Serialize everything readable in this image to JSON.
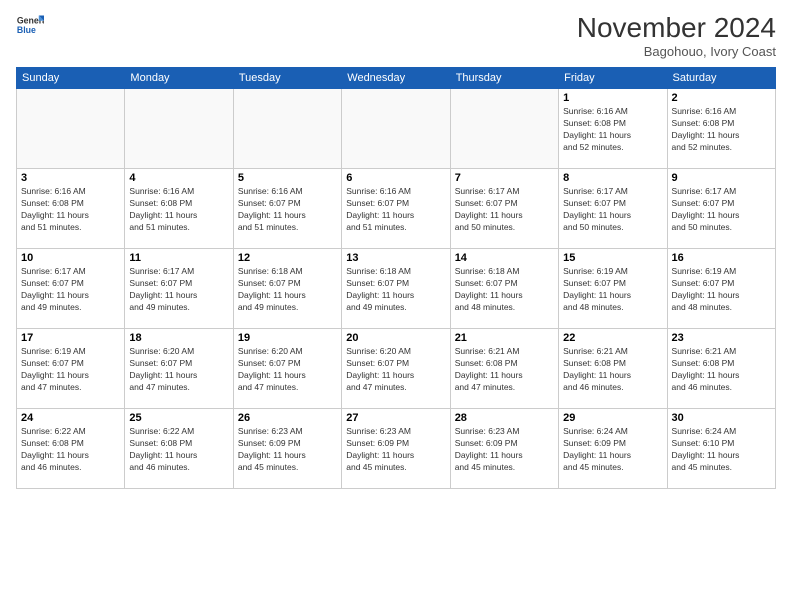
{
  "header": {
    "logo": {
      "line1": "General",
      "line2": "Blue"
    },
    "title": "November 2024",
    "subtitle": "Bagohouo, Ivory Coast"
  },
  "weekdays": [
    "Sunday",
    "Monday",
    "Tuesday",
    "Wednesday",
    "Thursday",
    "Friday",
    "Saturday"
  ],
  "weeks": [
    [
      {
        "day": "",
        "info": ""
      },
      {
        "day": "",
        "info": ""
      },
      {
        "day": "",
        "info": ""
      },
      {
        "day": "",
        "info": ""
      },
      {
        "day": "",
        "info": ""
      },
      {
        "day": "1",
        "info": "Sunrise: 6:16 AM\nSunset: 6:08 PM\nDaylight: 11 hours\nand 52 minutes."
      },
      {
        "day": "2",
        "info": "Sunrise: 6:16 AM\nSunset: 6:08 PM\nDaylight: 11 hours\nand 52 minutes."
      }
    ],
    [
      {
        "day": "3",
        "info": "Sunrise: 6:16 AM\nSunset: 6:08 PM\nDaylight: 11 hours\nand 51 minutes."
      },
      {
        "day": "4",
        "info": "Sunrise: 6:16 AM\nSunset: 6:08 PM\nDaylight: 11 hours\nand 51 minutes."
      },
      {
        "day": "5",
        "info": "Sunrise: 6:16 AM\nSunset: 6:07 PM\nDaylight: 11 hours\nand 51 minutes."
      },
      {
        "day": "6",
        "info": "Sunrise: 6:16 AM\nSunset: 6:07 PM\nDaylight: 11 hours\nand 51 minutes."
      },
      {
        "day": "7",
        "info": "Sunrise: 6:17 AM\nSunset: 6:07 PM\nDaylight: 11 hours\nand 50 minutes."
      },
      {
        "day": "8",
        "info": "Sunrise: 6:17 AM\nSunset: 6:07 PM\nDaylight: 11 hours\nand 50 minutes."
      },
      {
        "day": "9",
        "info": "Sunrise: 6:17 AM\nSunset: 6:07 PM\nDaylight: 11 hours\nand 50 minutes."
      }
    ],
    [
      {
        "day": "10",
        "info": "Sunrise: 6:17 AM\nSunset: 6:07 PM\nDaylight: 11 hours\nand 49 minutes."
      },
      {
        "day": "11",
        "info": "Sunrise: 6:17 AM\nSunset: 6:07 PM\nDaylight: 11 hours\nand 49 minutes."
      },
      {
        "day": "12",
        "info": "Sunrise: 6:18 AM\nSunset: 6:07 PM\nDaylight: 11 hours\nand 49 minutes."
      },
      {
        "day": "13",
        "info": "Sunrise: 6:18 AM\nSunset: 6:07 PM\nDaylight: 11 hours\nand 49 minutes."
      },
      {
        "day": "14",
        "info": "Sunrise: 6:18 AM\nSunset: 6:07 PM\nDaylight: 11 hours\nand 48 minutes."
      },
      {
        "day": "15",
        "info": "Sunrise: 6:19 AM\nSunset: 6:07 PM\nDaylight: 11 hours\nand 48 minutes."
      },
      {
        "day": "16",
        "info": "Sunrise: 6:19 AM\nSunset: 6:07 PM\nDaylight: 11 hours\nand 48 minutes."
      }
    ],
    [
      {
        "day": "17",
        "info": "Sunrise: 6:19 AM\nSunset: 6:07 PM\nDaylight: 11 hours\nand 47 minutes."
      },
      {
        "day": "18",
        "info": "Sunrise: 6:20 AM\nSunset: 6:07 PM\nDaylight: 11 hours\nand 47 minutes."
      },
      {
        "day": "19",
        "info": "Sunrise: 6:20 AM\nSunset: 6:07 PM\nDaylight: 11 hours\nand 47 minutes."
      },
      {
        "day": "20",
        "info": "Sunrise: 6:20 AM\nSunset: 6:07 PM\nDaylight: 11 hours\nand 47 minutes."
      },
      {
        "day": "21",
        "info": "Sunrise: 6:21 AM\nSunset: 6:08 PM\nDaylight: 11 hours\nand 47 minutes."
      },
      {
        "day": "22",
        "info": "Sunrise: 6:21 AM\nSunset: 6:08 PM\nDaylight: 11 hours\nand 46 minutes."
      },
      {
        "day": "23",
        "info": "Sunrise: 6:21 AM\nSunset: 6:08 PM\nDaylight: 11 hours\nand 46 minutes."
      }
    ],
    [
      {
        "day": "24",
        "info": "Sunrise: 6:22 AM\nSunset: 6:08 PM\nDaylight: 11 hours\nand 46 minutes."
      },
      {
        "day": "25",
        "info": "Sunrise: 6:22 AM\nSunset: 6:08 PM\nDaylight: 11 hours\nand 46 minutes."
      },
      {
        "day": "26",
        "info": "Sunrise: 6:23 AM\nSunset: 6:09 PM\nDaylight: 11 hours\nand 45 minutes."
      },
      {
        "day": "27",
        "info": "Sunrise: 6:23 AM\nSunset: 6:09 PM\nDaylight: 11 hours\nand 45 minutes."
      },
      {
        "day": "28",
        "info": "Sunrise: 6:23 AM\nSunset: 6:09 PM\nDaylight: 11 hours\nand 45 minutes."
      },
      {
        "day": "29",
        "info": "Sunrise: 6:24 AM\nSunset: 6:09 PM\nDaylight: 11 hours\nand 45 minutes."
      },
      {
        "day": "30",
        "info": "Sunrise: 6:24 AM\nSunset: 6:10 PM\nDaylight: 11 hours\nand 45 minutes."
      }
    ]
  ]
}
